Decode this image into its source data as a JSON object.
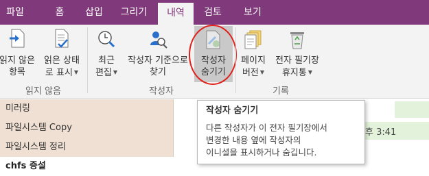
{
  "tabs": [
    {
      "label": "파일"
    },
    {
      "label": "홈"
    },
    {
      "label": "삽입"
    },
    {
      "label": "그리기"
    },
    {
      "label": "내역",
      "active": true
    },
    {
      "label": "검토"
    },
    {
      "label": "보기"
    }
  ],
  "ribbon": {
    "groups": {
      "unread": {
        "label": "읽지 않음"
      },
      "authors": {
        "label": "작성자"
      },
      "versions": {
        "label": "기록"
      }
    },
    "buttons": {
      "next_unread": {
        "line1": "읽지 않은",
        "line2": "항목"
      },
      "mark_read": {
        "line1": "읽은 상태",
        "line2": "로 표시"
      },
      "recent_edits": {
        "line1": "최근",
        "line2": "편집"
      },
      "find_by_author": {
        "line1": "작성자 기준으로",
        "line2": "찾기"
      },
      "hide_authors": {
        "line1": "작성자",
        "line2": "숨기기"
      },
      "page_versions": {
        "line1": "페이지",
        "line2": "버전"
      },
      "notebook_recycle_bin": {
        "line1": "전자 필기장",
        "line2": "휴지통"
      }
    },
    "accent_color": "#80397b"
  },
  "pages": [
    {
      "title": "미러링"
    },
    {
      "title": "파일시스템 Copy"
    },
    {
      "title": "파일시스템 정리"
    },
    {
      "title": "chfs 증설",
      "selected": true
    }
  ],
  "content": {
    "time_fragment": "후 3:41"
  },
  "tooltip": {
    "title": "작성자 숨기기",
    "line1": "다른 작성자가 이 전자 필기장에서",
    "line2": "변경한 내용 옆에 작성자의",
    "line3": "이니셜을 표시하거나 숨깁니다."
  }
}
